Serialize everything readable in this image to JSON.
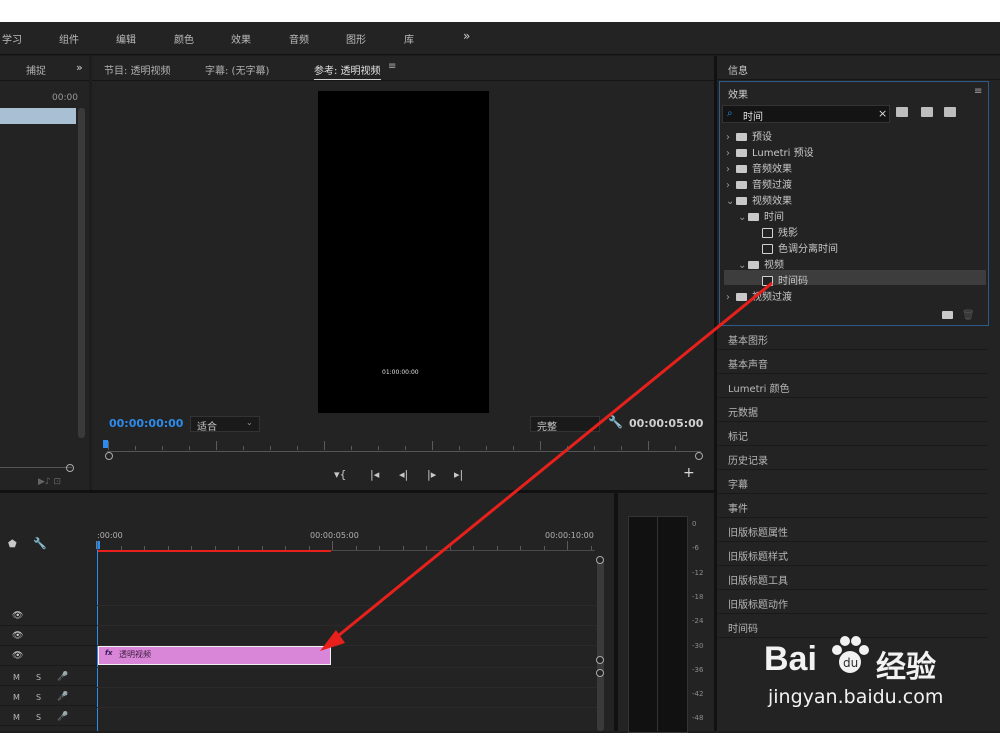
{
  "menu": [
    "学习",
    "组件",
    "编辑",
    "颜色",
    "效果",
    "音频",
    "图形",
    "库",
    "»"
  ],
  "left_panel": {
    "tab": "捕捉",
    "more": "»",
    "timecode": "00:00"
  },
  "monitor": {
    "tabs": [
      "节目: 透明视频",
      "字幕: (无字幕)",
      "参考: 透明视频",
      "≡"
    ],
    "overlay_timecode": "01:00:00:00",
    "current_time": "00:00:00:00",
    "fit_select": "适合",
    "quality_select": "完整",
    "duration": "00:00:05:00",
    "add": "+"
  },
  "right_panel": {
    "info_title": "信息",
    "effects_title": "效果",
    "menu_icon": "≡",
    "search_value": "时间",
    "clear": "×",
    "tree": [
      {
        "label": "预设",
        "chev": "›",
        "icon": "preset-folder"
      },
      {
        "label": "Lumetri 预设",
        "chev": "›",
        "icon": "preset-folder"
      },
      {
        "label": "音频效果",
        "chev": "›",
        "icon": "folder"
      },
      {
        "label": "音频过渡",
        "chev": "›",
        "icon": "folder"
      },
      {
        "label": "视频效果",
        "chev": "⌄",
        "icon": "folder"
      },
      {
        "label": "时间",
        "chev": "⌄",
        "icon": "folder"
      },
      {
        "label": "残影",
        "chev": "",
        "icon": "effect"
      },
      {
        "label": "色调分离时间",
        "chev": "",
        "icon": "effect"
      },
      {
        "label": "视频",
        "chev": "⌄",
        "icon": "folder"
      },
      {
        "label": "时间码",
        "chev": "",
        "icon": "effect",
        "selected": true
      },
      {
        "label": "视频过渡",
        "chev": "›",
        "icon": "folder"
      }
    ],
    "panels": [
      "基本图形",
      "基本声音",
      "Lumetri 颜色",
      "元数据",
      "标记",
      "历史记录",
      "字幕",
      "事件",
      "旧版标题属性",
      "旧版标题样式",
      "旧版标题工具",
      "旧版标题动作",
      "时间码"
    ]
  },
  "timeline": {
    "ruler_labels": [
      ":00:00",
      "00:00:05:00",
      "00:00:10:00"
    ],
    "clip_label": "透明视频",
    "clip_fx": "fx",
    "track_letters": [
      "M",
      "S"
    ]
  },
  "meter_labels": [
    "0",
    "-6",
    "-12",
    "-18",
    "-24",
    "-30",
    "-36",
    "-42",
    "-48"
  ],
  "watermark": {
    "brand_left": "Bai",
    "brand_right": "经验",
    "url": "jingyan.baidu.com"
  },
  "colors": {
    "accent_blue": "#2d8ceb",
    "clip_pink": "#d986d9",
    "arrow_red": "#e8201c",
    "effects_border": "#2d5a8a"
  }
}
